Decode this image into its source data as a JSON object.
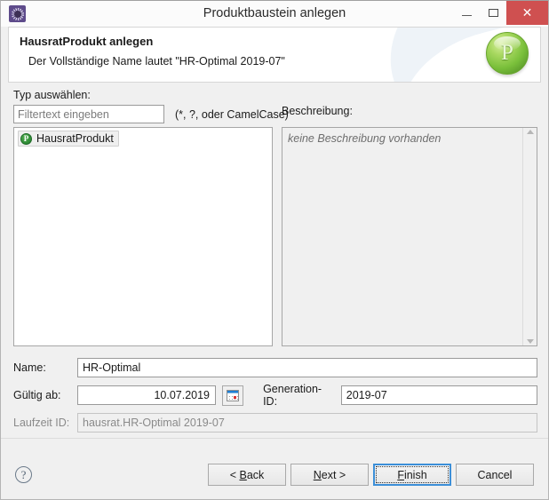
{
  "window": {
    "title": "Produktbaustein anlegen",
    "app_icon": "gear-icon",
    "minimize_label": "",
    "maximize_label": "",
    "close_label": "✕"
  },
  "banner": {
    "title": "HausratProdukt anlegen",
    "subtitle": "Der Vollständige Name lautet \"HR-Optimal 2019-07\"",
    "logo_letter": "P"
  },
  "type_section": {
    "label": "Typ auswählen:",
    "filter_placeholder": "Filtertext eingeben",
    "filter_value": "",
    "filter_hint": "(*, ?, oder CamelCase)",
    "items": [
      {
        "label": "HausratProdukt",
        "badge": "P",
        "selected": true
      }
    ]
  },
  "description_section": {
    "label": "Beschreibung:",
    "text": "keine Beschreibung vorhanden"
  },
  "form": {
    "name": {
      "label": "Name:",
      "value": "HR-Optimal"
    },
    "valid_from": {
      "label": "Gültig ab:",
      "value": "10.07.2019",
      "picker_icon": "calendar-icon"
    },
    "generation_id": {
      "label": "Generation-ID:",
      "value": "2019-07"
    },
    "runtime_id": {
      "label": "Laufzeit ID:",
      "value": "hausrat.HR-Optimal 2019-07"
    }
  },
  "buttons": {
    "help": "?",
    "back": {
      "pre": "< ",
      "mnemonic": "B",
      "post": "ack"
    },
    "next": {
      "pre": "",
      "mnemonic": "N",
      "post": "ext >"
    },
    "finish": {
      "pre": "",
      "mnemonic": "F",
      "post": "inish"
    },
    "cancel": {
      "pre": "",
      "mnemonic": "",
      "post": "Cancel"
    }
  },
  "colors": {
    "accent_close": "#cf5050",
    "focus_blue": "#3c8fd8",
    "logo_green": "#79bf3a",
    "body_bg": "#f0f0f0"
  }
}
